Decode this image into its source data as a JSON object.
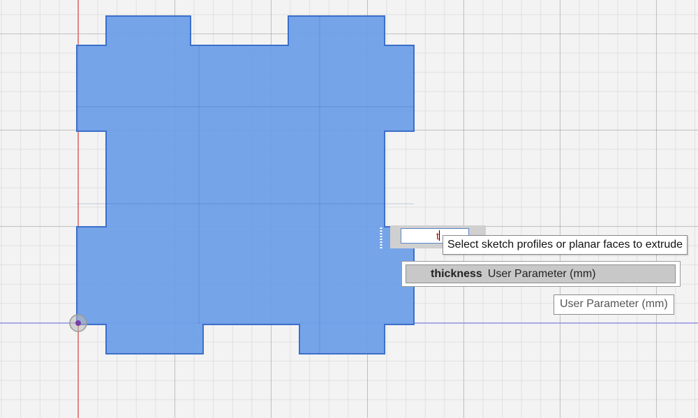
{
  "canvas": {
    "background_color": "#f3f3f3",
    "profile_fill_color": "#6e9fe8",
    "profile_edge_color": "#3d6fc9",
    "x_axis_color": "#9a9ae6",
    "y_axis_color": "#e66a6a"
  },
  "extrude_input": {
    "value": "t"
  },
  "hint_tooltip": {
    "text": "Select sketch profiles or planar faces to extrude"
  },
  "autocomplete": {
    "items": [
      {
        "name": "thickness",
        "type": "User Parameter (mm)"
      }
    ]
  },
  "type_tooltip": {
    "text": "User Parameter (mm)"
  },
  "icons": {
    "origin": "sketch-origin-icon",
    "handle": "extrude-drag-handle-icon"
  }
}
